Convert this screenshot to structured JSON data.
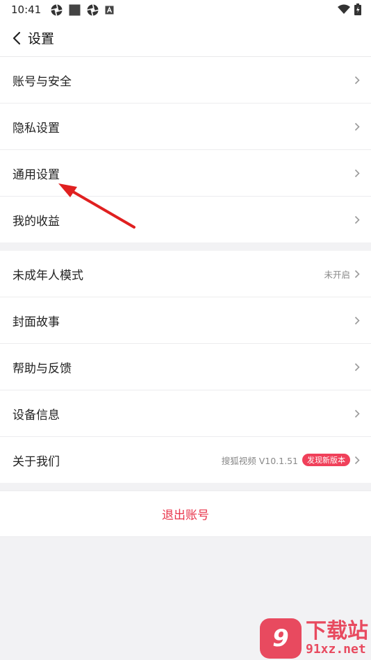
{
  "status_bar": {
    "time": "10:41",
    "left_icons": [
      "aperture-icon",
      "square-icon",
      "aperture-icon",
      "a-box-icon"
    ],
    "right_icons": [
      "wifi-icon",
      "battery-charging-icon"
    ]
  },
  "header": {
    "back_icon": "chevron-left-icon",
    "title": "设置"
  },
  "group1": {
    "items": [
      {
        "label": "账号与安全",
        "value": "",
        "badge": ""
      },
      {
        "label": "隐私设置",
        "value": "",
        "badge": ""
      },
      {
        "label": "通用设置",
        "value": "",
        "badge": ""
      },
      {
        "label": "我的收益",
        "value": "",
        "badge": ""
      }
    ]
  },
  "group2": {
    "items": [
      {
        "label": "未成年人模式",
        "value": "未开启",
        "badge": ""
      },
      {
        "label": "封面故事",
        "value": "",
        "badge": ""
      },
      {
        "label": "帮助与反馈",
        "value": "",
        "badge": ""
      },
      {
        "label": "设备信息",
        "value": "",
        "badge": ""
      },
      {
        "label": "关于我们",
        "value": "搜狐视频 V10.1.51",
        "badge": "发现新版本"
      }
    ]
  },
  "logout": {
    "label": "退出账号"
  },
  "annotation": {
    "arrow_color": "#e02020"
  },
  "watermark": {
    "logo": "9",
    "text": "下载站",
    "domain": "91xz.net"
  },
  "colors": {
    "accent": "#e8344a",
    "badge_bg": "#f0405a",
    "page_bg": "#f2f2f4"
  }
}
